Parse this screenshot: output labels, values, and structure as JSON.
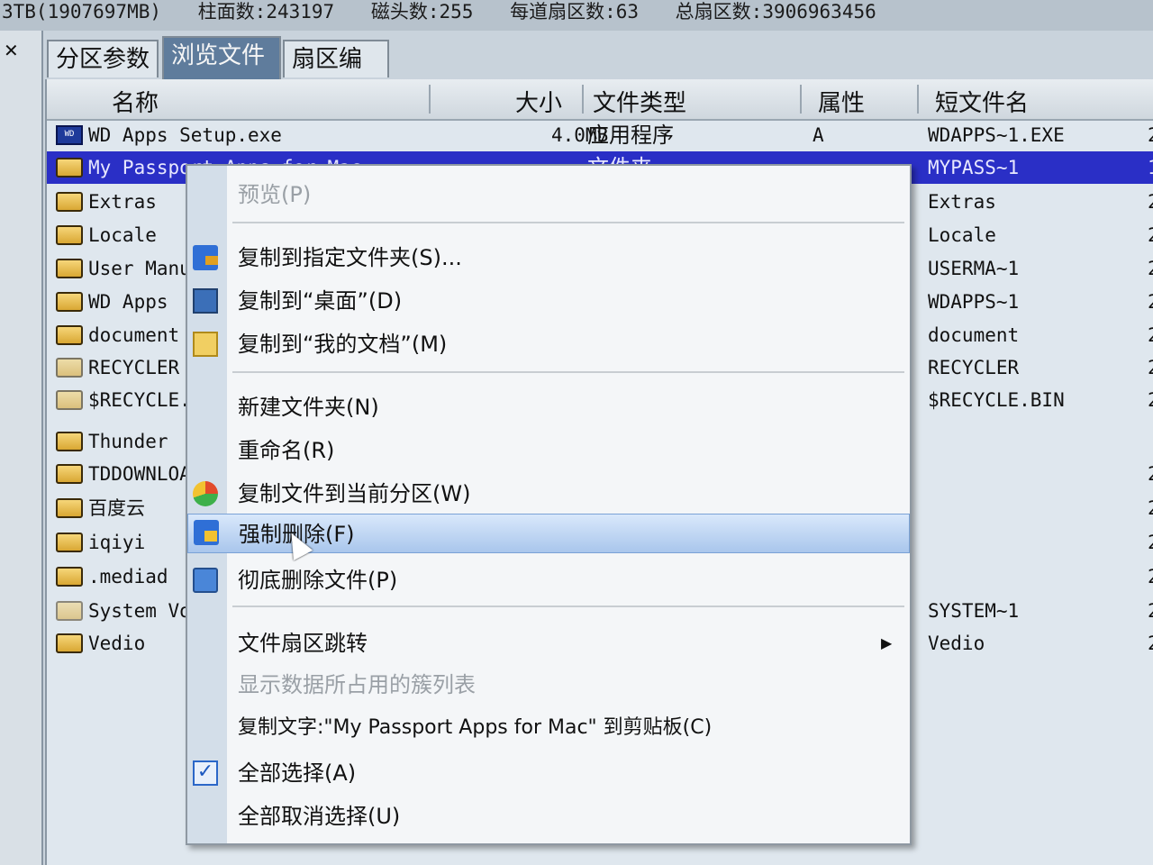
{
  "infobar": {
    "capacity": "3TB(1907697MB)",
    "cylinders": "柱面数:243197",
    "heads": "磁头数:255",
    "sectors_per_track": "每道扇区数:63",
    "total_sectors": "总扇区数:3906963456"
  },
  "tabs": [
    "分区参数",
    "浏览文件",
    "扇区编辑"
  ],
  "active_tab": "浏览文件",
  "columns": {
    "name": "名称",
    "size": "大小",
    "type": "文件类型",
    "attr": "属性",
    "short": "短文件名"
  },
  "files": [
    {
      "name": "WD Apps Setup.exe",
      "size": "4.0MB",
      "type": "应用程序",
      "attr": "A",
      "short": "WDAPPS~1.EXE",
      "icon": "exe-icon"
    },
    {
      "name": "My Passport Apps for Mac",
      "size": "",
      "type": "文件夹",
      "attr": "",
      "short": "MYPASS~1",
      "icon": "folder-icon",
      "selected": true
    },
    {
      "name": "Extras",
      "short": "Extras",
      "icon": "folder-icon"
    },
    {
      "name": "Locale",
      "short": "Locale",
      "icon": "folder-icon"
    },
    {
      "name": "User Manuals",
      "short": "USERMA~1",
      "icon": "folder-icon"
    },
    {
      "name": "WD Apps",
      "short": "WDAPPS~1",
      "icon": "folder-icon"
    },
    {
      "name": "document",
      "short": "document",
      "icon": "folder-icon"
    },
    {
      "name": "RECYCLER",
      "short": "RECYCLER",
      "icon": "folder-icon"
    },
    {
      "name": "$RECYCLE.BIN",
      "short": "$RECYCLE.BIN",
      "icon": "folder-icon"
    },
    {
      "name": "Thunder",
      "short": "",
      "icon": "folder-icon"
    },
    {
      "name": "TDDOWNLOAD",
      "short": "",
      "icon": "folder-icon"
    },
    {
      "name": "百度云",
      "short": "",
      "icon": "folder-icon"
    },
    {
      "name": "iqiyi",
      "short": "",
      "icon": "folder-icon"
    },
    {
      "name": ".mediad",
      "short": "",
      "icon": "folder-icon"
    },
    {
      "name": "System Volume Information",
      "short": "SYSTEM~1",
      "icon": "folder-icon"
    },
    {
      "name": "Vedio",
      "short": "Vedio",
      "icon": "folder-icon"
    }
  ],
  "edge_marks": [
    "2",
    "1",
    "2",
    "2",
    "2",
    "2",
    "2",
    "2",
    "2",
    "",
    "2",
    "2",
    "2",
    "2",
    "2",
    "2"
  ],
  "menu": {
    "preview": "预览(P)",
    "copy_to_folder": "复制到指定文件夹(S)...",
    "copy_to_desktop": "复制到“桌面”(D)",
    "copy_to_documents": "复制到“我的文档”(M)",
    "new_folder": "新建文件夹(N)",
    "rename": "重命名(R)",
    "copy_to_partition": "复制文件到当前分区(W)",
    "force_delete": "强制删除(F)",
    "wipe_delete": "彻底删除文件(P)",
    "sector_jump": "文件扇区跳转",
    "show_clusters": "显示数据所占用的簇列表",
    "copy_text": "复制文字:\"My Passport Apps for Mac\" 到剪贴板(C)",
    "select_all": "全部选择(A)",
    "deselect_all": "全部取消选择(U)",
    "submenu_arrow": "▶"
  }
}
